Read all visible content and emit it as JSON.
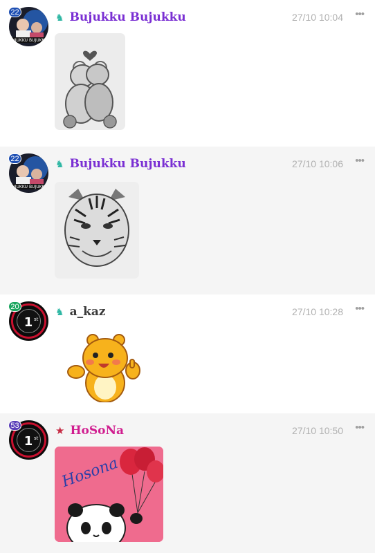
{
  "messages": [
    {
      "level": "22",
      "level_color": "#1e4fb3",
      "badge": "♞",
      "username": "Bujukku Bujukku",
      "name_color": "#7a2fd3",
      "time": "27/10 10:04",
      "more": "•••",
      "image": "sketch-teddy-bears-hugging"
    },
    {
      "level": "22",
      "level_color": "#1e4fb3",
      "badge": "♞",
      "username": "Bujukku Bujukku",
      "name_color": "#7a2fd3",
      "time": "27/10 10:06",
      "more": "•••",
      "image": "sketch-tiger"
    },
    {
      "level": "20",
      "level_color": "#1aa55e",
      "badge": "♞",
      "username": "a_kaz",
      "name_color": "#3a3a3a",
      "time": "27/10 10:28",
      "more": "•••",
      "image": "sticker-yellow-bear-thumbs-up"
    },
    {
      "level": "53",
      "level_color": "#5a3fb8",
      "badge": "★",
      "username": "HoSoNa",
      "name_color": "#d01d8f",
      "time": "27/10 10:50",
      "more": "•••",
      "image": "panda-with-balloons-card",
      "image_text": "Hosona"
    }
  ],
  "colors": {
    "badge_teal": "#2fb7a4",
    "badge_star": "#c62b44",
    "shaded_bg": "#f5f5f5"
  }
}
